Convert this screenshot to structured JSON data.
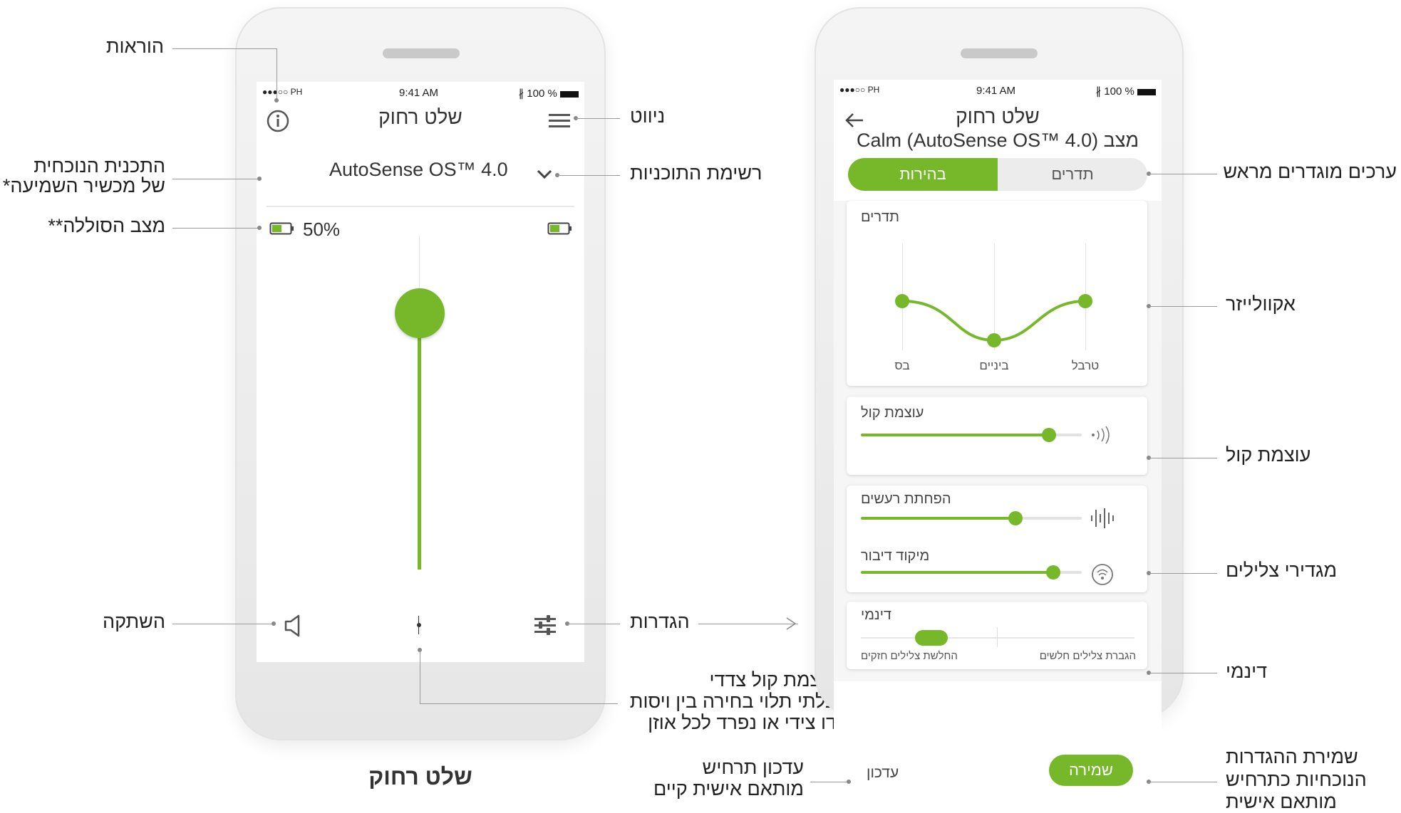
{
  "left_phone": {
    "status": {
      "carrier": "●●●○○ PH",
      "time": "9:41 AM",
      "battery": "100 %"
    },
    "title": "שלט רחוק",
    "program": "AutoSense OS™ 4.0",
    "battery_percent": "50%",
    "caption": "שלט רחוק"
  },
  "right_phone": {
    "status": {
      "carrier": "●●●○○ PH",
      "time": "9:41 AM",
      "battery": "100 %"
    },
    "title": "שלט רחוק",
    "subtitle": "מצב Calm (AutoSense OS™ 4.0)",
    "tabs": {
      "active": "בהירות",
      "inactive": "תדרים"
    },
    "equalizer": {
      "title": "תדרים",
      "labels": [
        "טרבל",
        "ביניים",
        "בס"
      ]
    },
    "volume": {
      "title": "עוצמת קול",
      "level": 0.85
    },
    "noise_reduction": {
      "title": "הפחתת רעשים",
      "level": 0.7
    },
    "speech_focus": {
      "title": "מיקוד דיבור",
      "level": 0.87
    },
    "dynamic": {
      "title": "דינמי",
      "right_label": "הגברת צלילים חלשים",
      "left_label": "החלשת צלילים חזקים"
    },
    "update_label": "עדכון",
    "save_label": "שמירה"
  },
  "annotations": {
    "instructions": "הוראות",
    "current_program_line1": "התכנית הנוכחית",
    "current_program_line2": "של מכשיר השמיעה*",
    "battery_status": "מצב הסוללה**",
    "mute": "השתקה",
    "navigation": "ניווט",
    "program_list": "רשימת התוכניות",
    "settings": "הגדרות",
    "side_volume_line1": "עוצמת קול צדדי",
    "side_volume_line2": "בלתי תלוי בחירה בין ויסות",
    "side_volume_line3": "דו צידי או נפרד לכל אוזן",
    "update_line1": "עדכון תרחיש",
    "update_line2": "מותאם אישית קיים",
    "presets": "ערכים מוגדרים מראש",
    "equalizer": "אקוולייזר",
    "volume": "עוצמת קול",
    "sound_settings": "מגדירי צלילים",
    "dynamic": "דינמי",
    "save_line1": "שמירת ההגדרות",
    "save_line2": "הנוכחיות כתרחיש",
    "save_line3": "מותאם אישית"
  },
  "colors": {
    "accent": "#76b82a"
  }
}
